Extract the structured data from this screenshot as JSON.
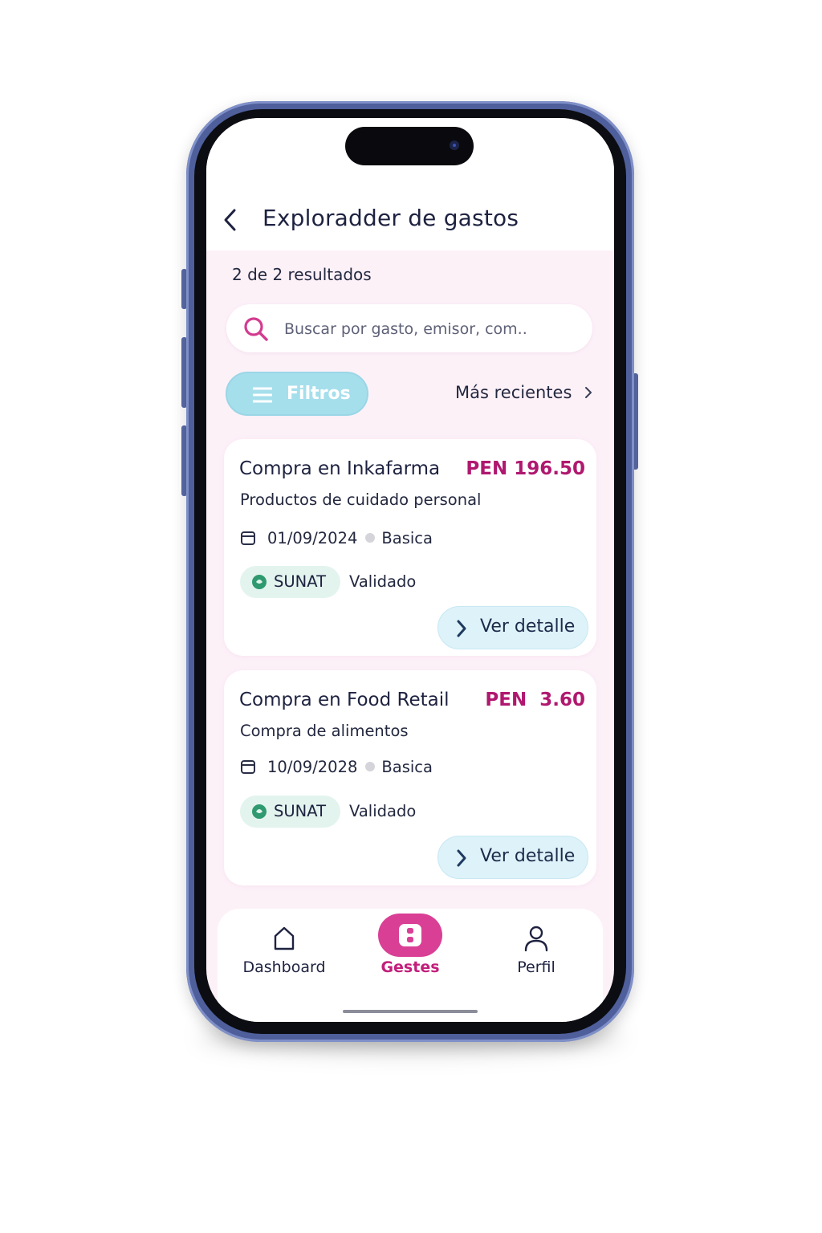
{
  "header": {
    "title": "Exploradder de gastos"
  },
  "results": {
    "count_text": "2 de 2 resultados"
  },
  "search": {
    "placeholder": "Buscar por gasto, emisor, com.."
  },
  "filters": {
    "label": "Filtros"
  },
  "sort": {
    "label": "Más recientes"
  },
  "expenses": [
    {
      "title": "Compra en Inkafarma",
      "amount": "PEN 196.50",
      "description": "Productos de cuidado personal",
      "date": "01/09/2024",
      "category": "Basica",
      "badge": "SUNAT",
      "status": "Validado",
      "action": "Ver detalle"
    },
    {
      "title": "Compra en Food Retail",
      "amount": "PEN  3.60",
      "description": "Compra de alimentos",
      "date": "10/09/2028",
      "category": "Basica",
      "badge": "SUNAT",
      "status": "Validado",
      "action": "Ver detalle"
    }
  ],
  "nav": {
    "items": [
      {
        "label": "Dashboard",
        "icon": "home-icon"
      },
      {
        "label": "Gestes",
        "icon": "expenses-icon",
        "active": true
      },
      {
        "label": "Perfil",
        "icon": "user-icon"
      }
    ]
  },
  "colors": {
    "accent": "#d93f95",
    "amount": "#b0186f",
    "filter_button": "#a6dfec",
    "detail_button": "#ddf2f9",
    "badge_bg": "#e3f4ee",
    "badge_icon": "#2f9a6f",
    "screen_bg": "#fdf1f8"
  }
}
